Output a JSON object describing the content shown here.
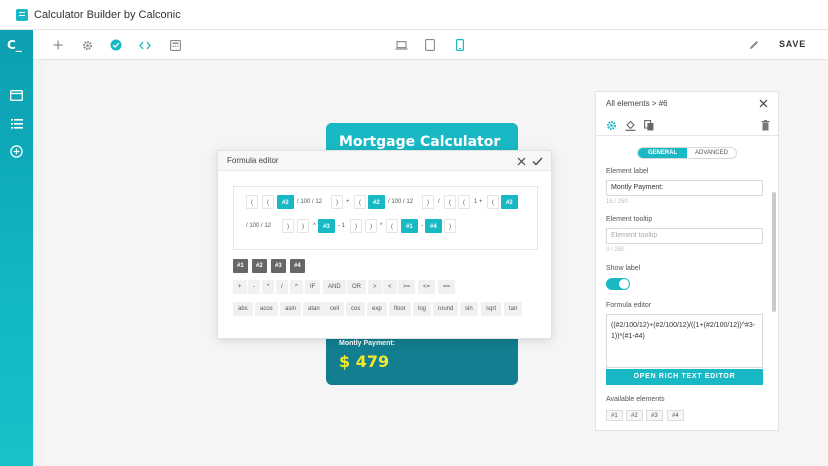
{
  "app": {
    "title": "Calculator Builder by Calconic",
    "brand": "C_"
  },
  "sidebar": {
    "items": [
      {
        "icon": "card-icon"
      },
      {
        "icon": "list-icon"
      },
      {
        "icon": "add-circle-icon"
      }
    ]
  },
  "toolbar": {
    "icons": [
      "plus-icon",
      "gear-icon",
      "check-circle-icon",
      "code-icon",
      "calculator-icon"
    ],
    "devices": [
      "laptop-icon",
      "tablet-icon",
      "phone-icon"
    ],
    "active_device": "phone-icon",
    "save_label": "SAVE"
  },
  "calculator": {
    "title": "Mortgage Calculator",
    "payment_label": "Montly Payment:",
    "payment_value": "$ 479"
  },
  "formula_editor": {
    "title": "Formula editor",
    "tokens_row1": [
      "(",
      "(",
      "#2",
      "/ 100 / 12",
      ")",
      "+",
      "(",
      "#2",
      "/ 100 / 12",
      ")",
      "/",
      "(",
      "(",
      "1 +",
      "(",
      "#2"
    ],
    "tokens_row2": [
      "/ 100 / 12",
      ")",
      ")",
      "^",
      "#3",
      "- 1",
      ")",
      ")",
      "*",
      "(",
      "#1",
      "-",
      "#4",
      ")"
    ],
    "variables": [
      "#1",
      "#2",
      "#3",
      "#4"
    ],
    "operators": [
      "+",
      "-",
      "*",
      "/",
      "^",
      "IF",
      "AND",
      "OR",
      ">",
      "<",
      ">=",
      "<=",
      "=="
    ],
    "functions": [
      "abs",
      "acos",
      "asin",
      "atan",
      "ceil",
      "cos",
      "exp",
      "floor",
      "log",
      "round",
      "sin",
      "sqrt",
      "tan"
    ]
  },
  "panel": {
    "breadcrumb": "All elements > #6",
    "tab_general": "GENERAL",
    "tab_advanced": "ADVANCED",
    "element_label_title": "Element label",
    "element_label_value": "Montly Payment:",
    "element_label_count": "15 / 250",
    "tooltip_title": "Element tooltip",
    "tooltip_placeholder": "Element tooltip",
    "tooltip_count": "0 / 250",
    "show_label_title": "Show label",
    "show_label_on": true,
    "formula_title": "Formula editor",
    "formula_value": "((#2/100/12)+(#2/100/12)/((1+(#2/100/12))^#3-1))*(#1-#4)",
    "rich_button": "OPEN RICH TEXT EDITOR",
    "available_title": "Available elements",
    "available": [
      "#1",
      "#2",
      "#3",
      "#4"
    ]
  },
  "colors": {
    "accent": "#18b9c4",
    "card": "#127e8f",
    "value": "#f2ea2b"
  }
}
